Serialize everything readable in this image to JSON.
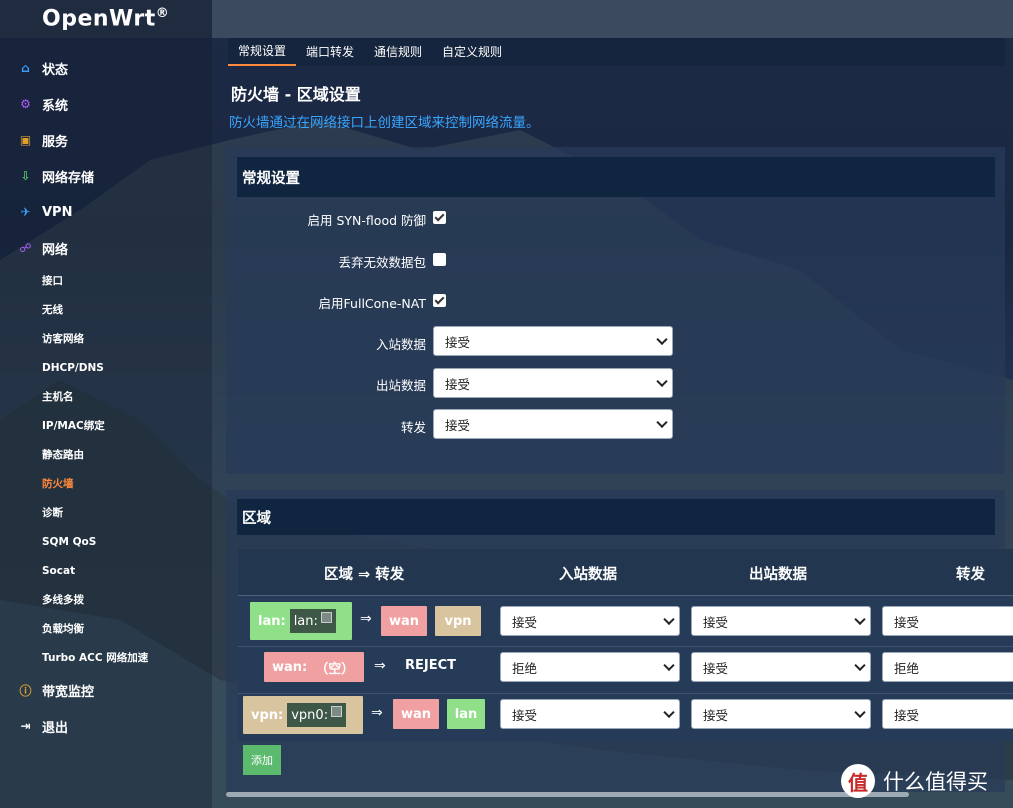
{
  "brand": {
    "name": "OpenWrt",
    "mark": "®"
  },
  "sidebar": {
    "top_items": [
      {
        "label": "状态",
        "icon": "home-icon",
        "color": "#3aa0ff"
      },
      {
        "label": "系统",
        "icon": "gear-icon",
        "color": "#b25cff"
      },
      {
        "label": "服务",
        "icon": "monitor-icon",
        "color": "#e0a030"
      },
      {
        "label": "网络存储",
        "icon": "download-icon",
        "color": "#56c16a"
      },
      {
        "label": "VPN",
        "icon": "plane-icon",
        "color": "#3aa0ff"
      },
      {
        "label": "网络",
        "icon": "network-icon",
        "color": "#b25cff"
      }
    ],
    "sub_items": [
      "接口",
      "无线",
      "访客网络",
      "DHCP/DNS",
      "主机名",
      "IP/MAC绑定",
      "静态路由",
      "防火墙",
      "诊断",
      "SQM QoS",
      "Socat",
      "多线多拨",
      "负载均衡",
      "Turbo ACC 网络加速"
    ],
    "active_sub": "防火墙",
    "bottom_items": [
      {
        "label": "带宽监控",
        "icon": "info-icon",
        "color": "#e0a030"
      },
      {
        "label": "退出",
        "icon": "logout-icon",
        "color": "#ffffff"
      }
    ]
  },
  "tabs": [
    "常规设置",
    "端口转发",
    "通信规则",
    "自定义规则"
  ],
  "page": {
    "title": "防火墙 - 区域设置",
    "description": "防火墙通过在网络接口上创建区域来控制网络流量。"
  },
  "general": {
    "heading": "常规设置",
    "syn_flood_label": "启用 SYN-flood 防御",
    "syn_flood_checked": true,
    "drop_invalid_label": "丢弃无效数据包",
    "drop_invalid_checked": false,
    "fullcone_label": "启用FullCone-NAT",
    "fullcone_checked": true,
    "input_label": "入站数据",
    "input_value": "接受",
    "output_label": "出站数据",
    "output_value": "接受",
    "forward_label": "转发",
    "forward_value": "接受"
  },
  "zones": {
    "heading": "区域",
    "columns": [
      "区域 ⇒ 转发",
      "入站数据",
      "出站数据",
      "转发"
    ],
    "rows": [
      {
        "zone": "lan:",
        "iface": "lan:",
        "arrow": "⇒",
        "targets": [
          "wan",
          "vpn"
        ],
        "input": "接受",
        "output": "接受",
        "forward": "接受"
      },
      {
        "zone": "wan:",
        "iface": "（空）",
        "arrow": "⇒",
        "targets": [
          "REJECT"
        ],
        "input": "拒绝",
        "output": "接受",
        "forward": "拒绝"
      },
      {
        "zone": "vpn:",
        "iface": "vpn0:",
        "arrow": "⇒",
        "targets": [
          "wan",
          "lan"
        ],
        "input": "接受",
        "output": "接受",
        "forward": "接受"
      }
    ],
    "add_label": "添加"
  },
  "colors": {
    "lan": "#90e08a",
    "wan": "#f0a0a0",
    "vpn": "#d9c4a0",
    "accent": "#ff8a3d",
    "link": "#39a6ff"
  },
  "watermark": {
    "logo": "值",
    "text": "什么值得买"
  }
}
